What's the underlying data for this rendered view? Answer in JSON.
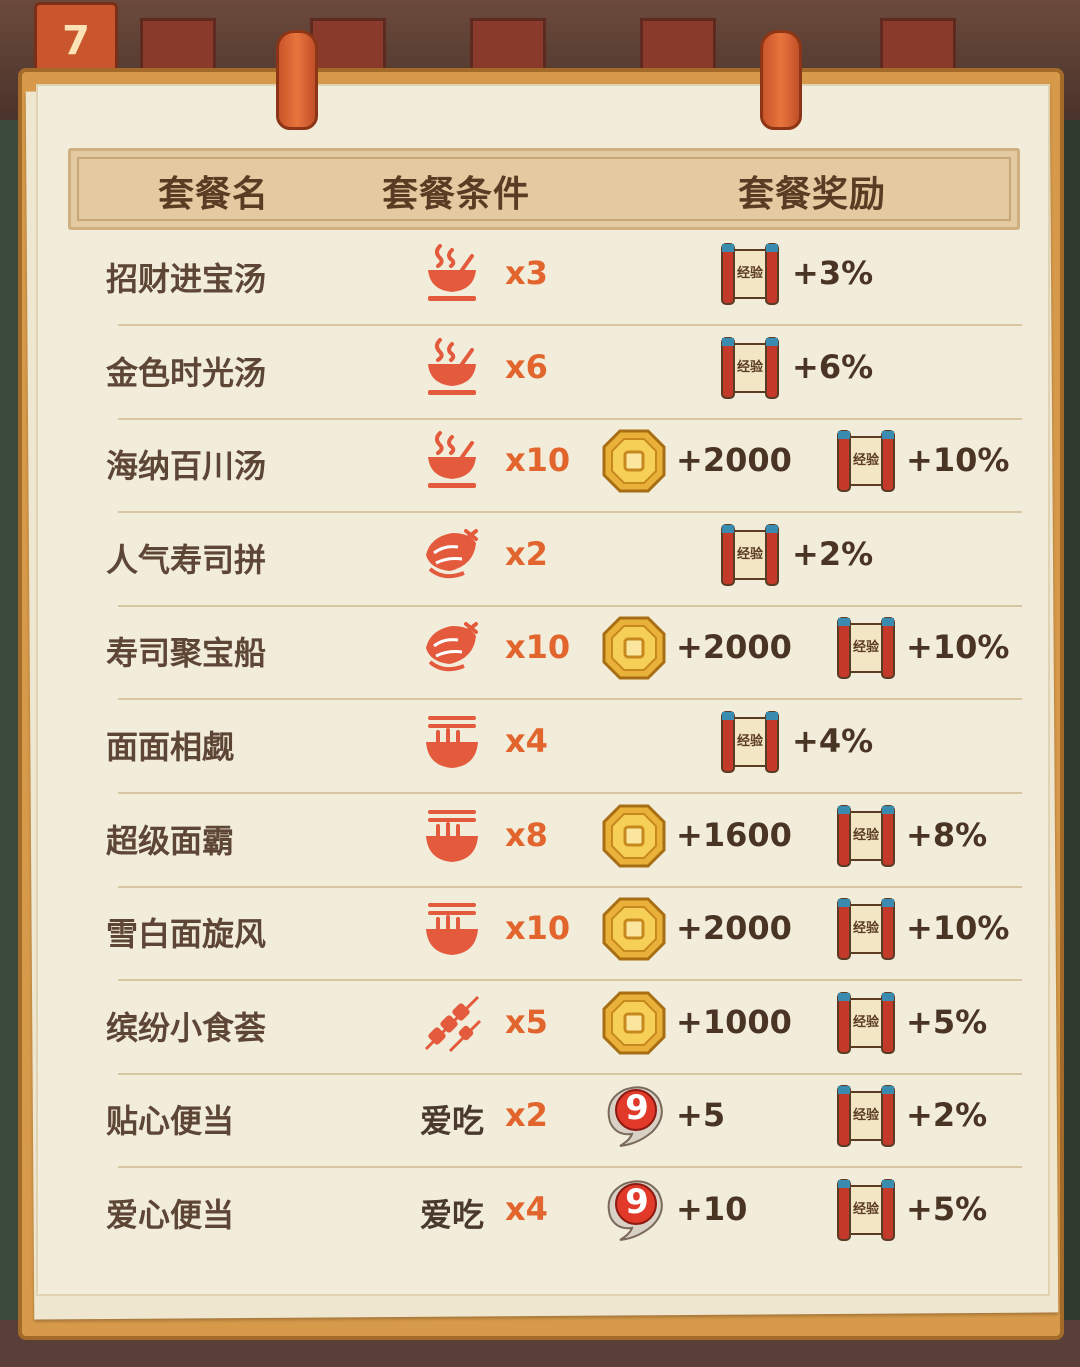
{
  "calendar_day": "7",
  "headers": {
    "name": "套餐名",
    "condition": "套餐条件",
    "reward": "套餐奖励"
  },
  "rows": [
    {
      "name": "招财进宝汤",
      "cond_icon": "soup-bowl-icon",
      "count": "x3",
      "rewards": [
        {
          "icon": "exp-scroll-icon",
          "text": "+3%"
        }
      ]
    },
    {
      "name": "金色时光汤",
      "cond_icon": "soup-bowl-icon",
      "count": "x6",
      "rewards": [
        {
          "icon": "exp-scroll-icon",
          "text": "+6%"
        }
      ]
    },
    {
      "name": "海纳百川汤",
      "cond_icon": "soup-bowl-icon",
      "count": "x10",
      "rewards": [
        {
          "icon": "gold-coin-icon",
          "text": "+2000"
        },
        {
          "icon": "exp-scroll-icon",
          "text": "+10%"
        }
      ]
    },
    {
      "name": "人气寿司拼",
      "cond_icon": "sushi-icon",
      "count": "x2",
      "rewards": [
        {
          "icon": "exp-scroll-icon",
          "text": "+2%"
        }
      ]
    },
    {
      "name": "寿司聚宝船",
      "cond_icon": "sushi-icon",
      "count": "x10",
      "rewards": [
        {
          "icon": "gold-coin-icon",
          "text": "+2000"
        },
        {
          "icon": "exp-scroll-icon",
          "text": "+10%"
        }
      ]
    },
    {
      "name": "面面相觑",
      "cond_icon": "noodle-bowl-icon",
      "count": "x4",
      "rewards": [
        {
          "icon": "exp-scroll-icon",
          "text": "+4%"
        }
      ]
    },
    {
      "name": "超级面霸",
      "cond_icon": "noodle-bowl-icon",
      "count": "x8",
      "rewards": [
        {
          "icon": "gold-coin-icon",
          "text": "+1600"
        },
        {
          "icon": "exp-scroll-icon",
          "text": "+8%"
        }
      ]
    },
    {
      "name": "雪白面旋风",
      "cond_icon": "noodle-bowl-icon",
      "count": "x10",
      "rewards": [
        {
          "icon": "gold-coin-icon",
          "text": "+2000"
        },
        {
          "icon": "exp-scroll-icon",
          "text": "+10%"
        }
      ]
    },
    {
      "name": "缤纷小食荟",
      "cond_icon": "skewer-icon",
      "count": "x5",
      "rewards": [
        {
          "icon": "gold-coin-icon",
          "text": "+1000"
        },
        {
          "icon": "exp-scroll-icon",
          "text": "+5%"
        }
      ]
    },
    {
      "name": "贴心便当",
      "cond_text": "爱吃",
      "count": "x2",
      "rewards": [
        {
          "icon": "number-nine-badge-icon",
          "text": "+5"
        },
        {
          "icon": "exp-scroll-icon",
          "text": "+2%"
        }
      ]
    },
    {
      "name": "爱心便当",
      "cond_text": "爱吃",
      "count": "x4",
      "rewards": [
        {
          "icon": "number-nine-badge-icon",
          "text": "+10"
        },
        {
          "icon": "exp-scroll-icon",
          "text": "+5%"
        }
      ]
    }
  ],
  "scroll_label": "经验",
  "badge_label": "9",
  "colors": {
    "accent": "#e2652d",
    "paper": "#f2ecdb",
    "header": "#e3caa0",
    "text": "#5e4636"
  }
}
